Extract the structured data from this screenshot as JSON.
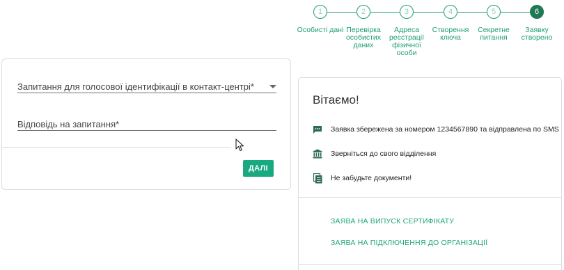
{
  "form": {
    "question_label": "Запитання для голосової ідентифікації в контакт-центрі*",
    "answer_label": "Відповідь на запитання*",
    "next_button": "ДАЛІ"
  },
  "stepper": {
    "steps": [
      {
        "number": "1",
        "label": "Особисті дані"
      },
      {
        "number": "2",
        "label": "Перевірка особистих даних"
      },
      {
        "number": "3",
        "label": "Адреса реєстрації фізичної особи"
      },
      {
        "number": "4",
        "label": "Створення ключа"
      },
      {
        "number": "5",
        "label": "Секретне питання"
      },
      {
        "number": "6",
        "label": "Заявку створено"
      }
    ],
    "active_step": 6
  },
  "result": {
    "title": "Вітаємо!",
    "messages": [
      {
        "icon": "sms-icon",
        "text": "Заявка збережена за номером 1234567890 та відправлена по SMS"
      },
      {
        "icon": "bank-icon",
        "text": "Зверніться до свого відділення"
      },
      {
        "icon": "documents-icon",
        "text": "Не забудьте документи!"
      }
    ],
    "links": [
      {
        "label": "ЗАЯВА НА ВИПУСК СЕРТИФІКАТУ"
      },
      {
        "label": "ЗАЯВА НА ПІДКЛЮЧЕННЯ ДО ОРГАНІЗАЦІЇ"
      }
    ]
  },
  "colors": {
    "accent": "#1f9e73",
    "button": "#19a980",
    "active_step": "#1f7a55"
  }
}
